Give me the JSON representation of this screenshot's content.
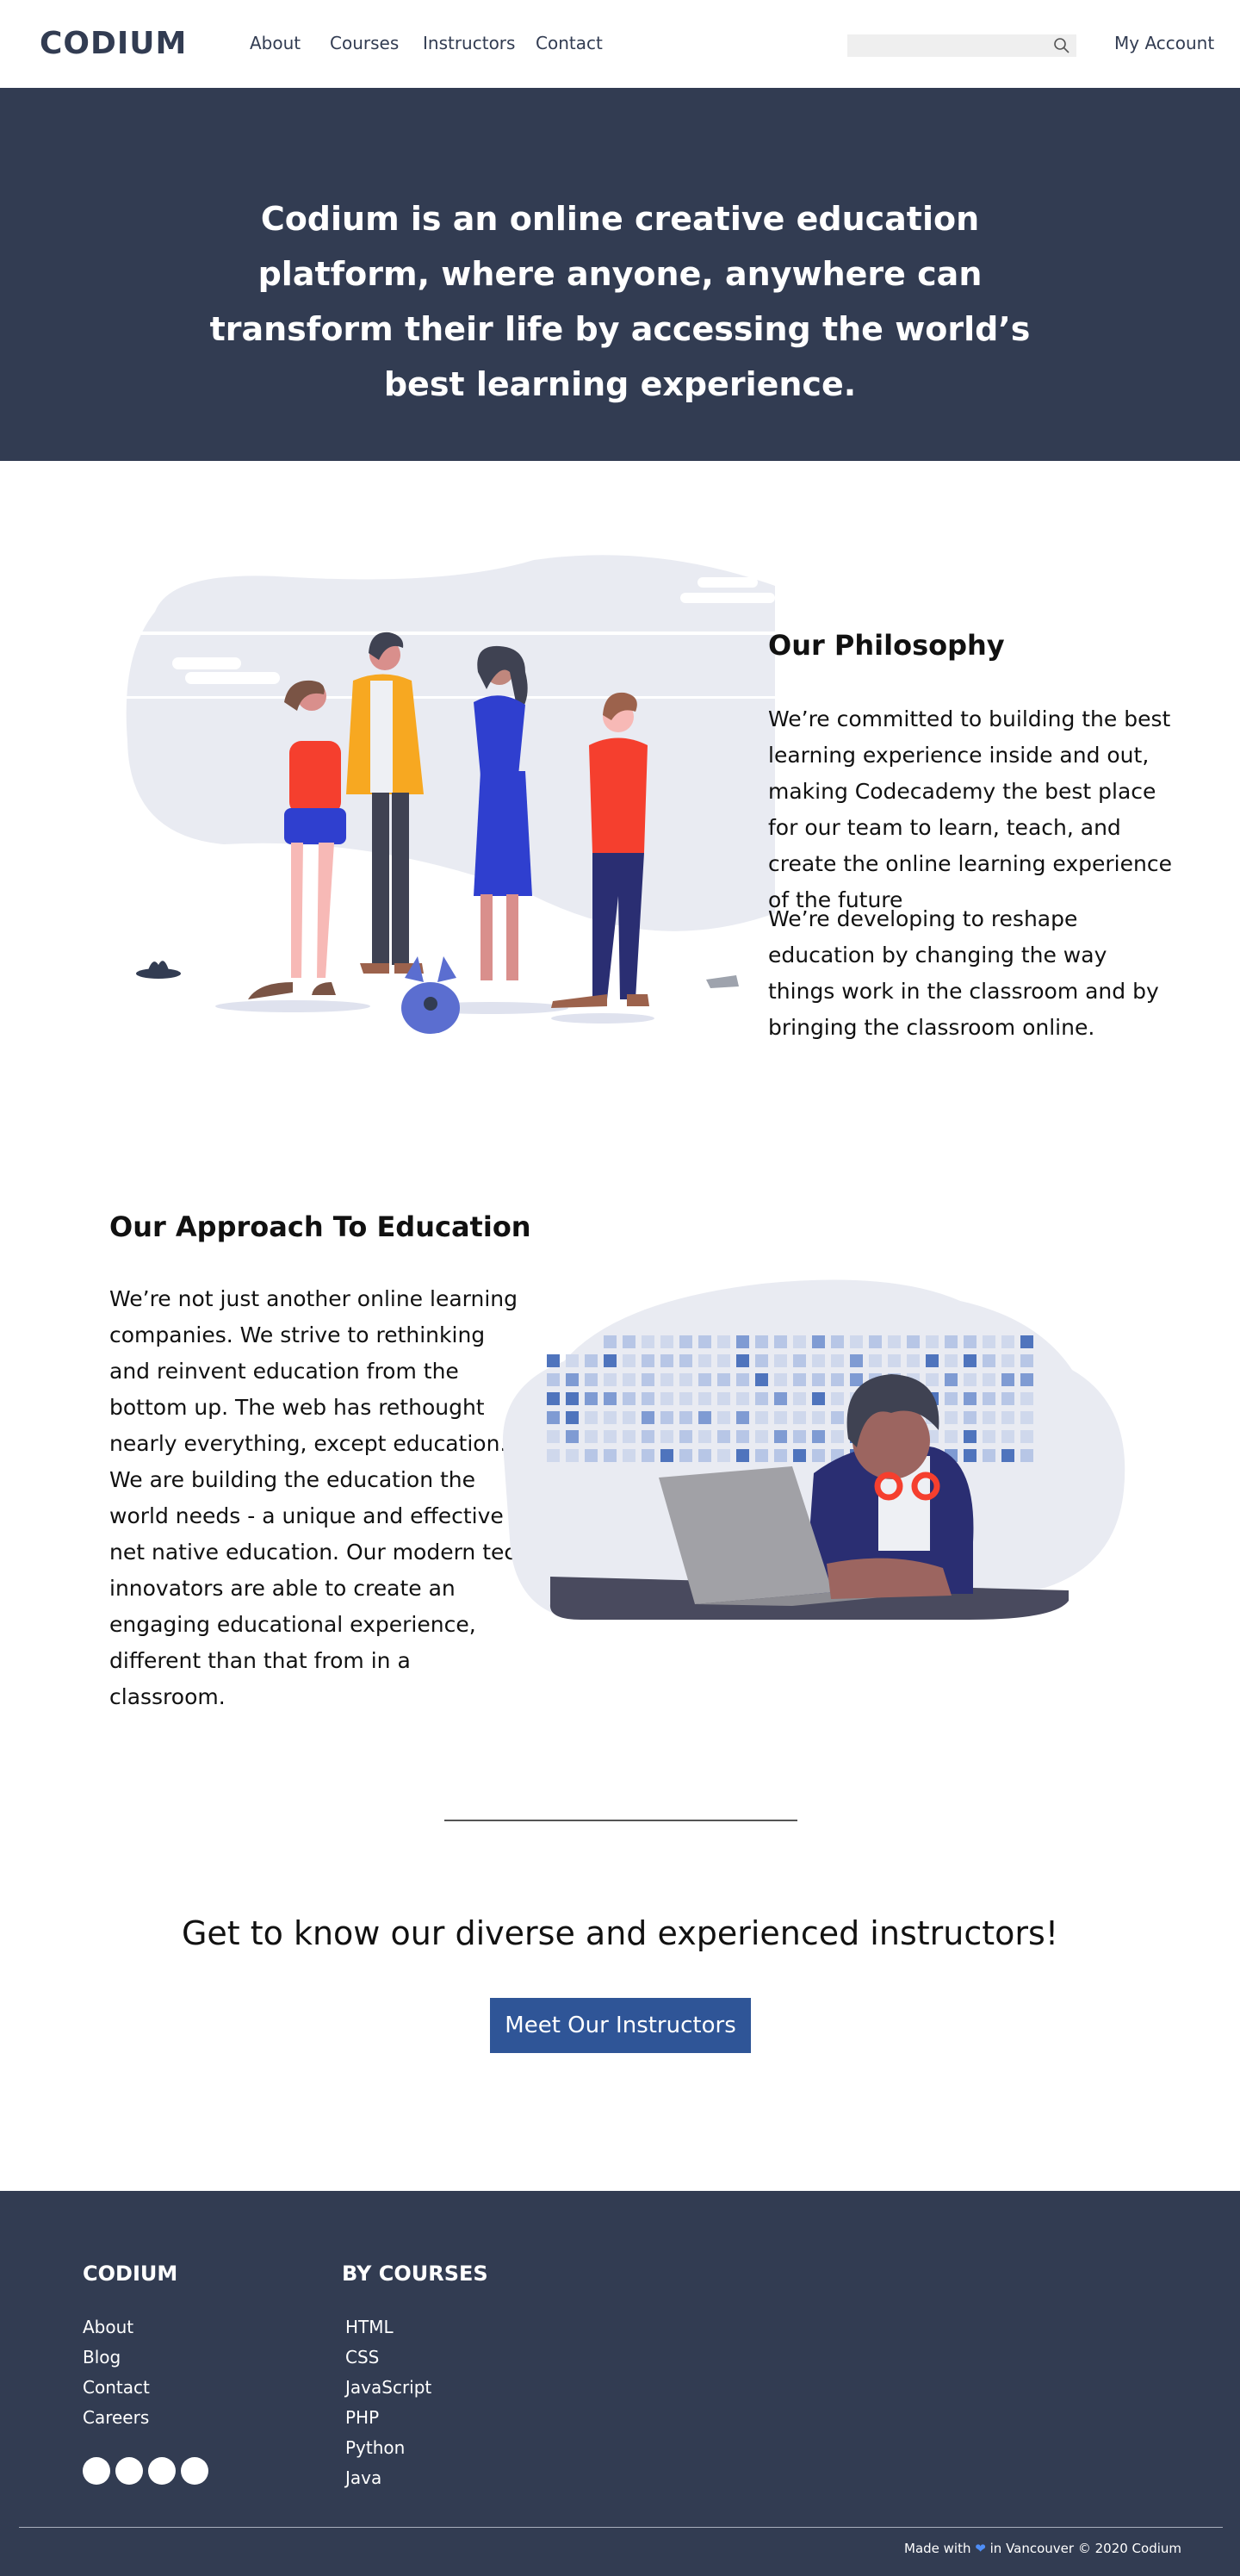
{
  "nav": {
    "logo": "CODIUM",
    "links": [
      "About",
      "Courses",
      "Instructors",
      "Contact"
    ],
    "search_placeholder": "",
    "account": "My Account"
  },
  "hero": {
    "text": "Codium is an online creative education platform, where anyone, anywhere can transform their life by accessing the world’s best learning experience."
  },
  "philosophy": {
    "title": "Our Philosophy",
    "p1": "We’re committed to building the best learning experience inside and out, making Codecademy the best place for our team to learn, teach, and create the online learning experience of the future",
    "p2": "We’re developing to reshape education by changing the way things work in the classroom and by bringing the classroom online."
  },
  "approach": {
    "title": "Our Approach To Education",
    "p1": "We’re not just another online learning companies. We strive to rethinking and reinvent education from the bottom up. The web has rethought nearly everything, except education. We are building the education the world needs - a unique and effective  net native education. Our modern tech innovators are able to create an engaging educational experience, different than that from in a classroom."
  },
  "cta": {
    "heading": "Get to know our diverse and experienced instructors!",
    "button": "Meet Our Instructors"
  },
  "footer": {
    "col1_title": "CODIUM",
    "col1_links": [
      "About",
      "Blog",
      "Contact",
      "Careers"
    ],
    "col2_title": "BY COURSES",
    "col2_links": [
      "HTML",
      "CSS",
      "JavaScript",
      "PHP",
      "Python",
      "Java"
    ],
    "credit_before": "Made with",
    "credit_after": "in Vancouver  ©  2020 Codium"
  },
  "icons": {
    "search": "search-icon",
    "heart": "heart-icon",
    "social": [
      "social-icon-1",
      "social-icon-2",
      "social-icon-3",
      "social-icon-4"
    ]
  },
  "colors": {
    "navy": "#323c52",
    "button": "#2f5597",
    "accent_red": "#f53f2e",
    "illustration_bg": "#e9ebf2"
  }
}
